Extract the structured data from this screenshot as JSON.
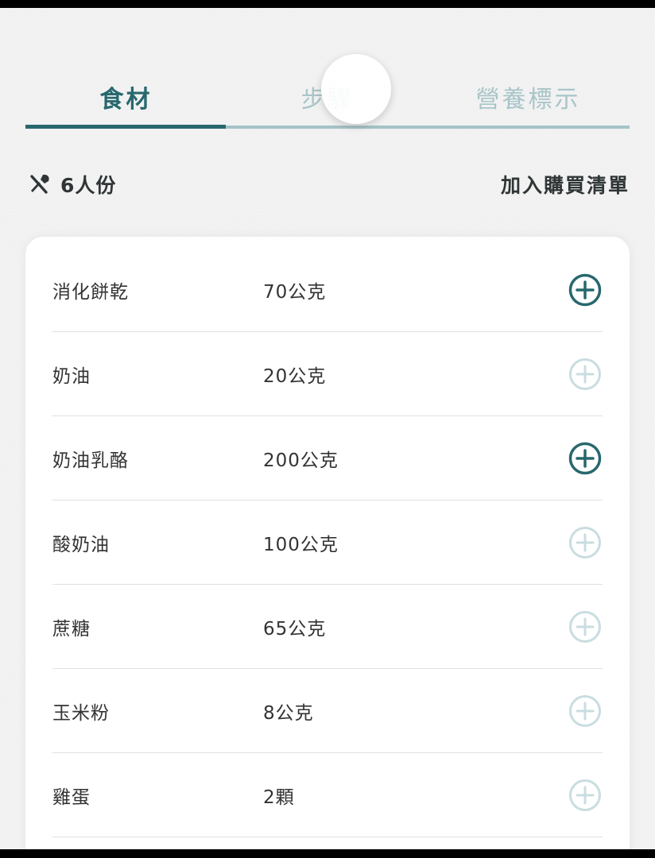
{
  "tabs": [
    {
      "label": "食材",
      "active": true
    },
    {
      "label": "步驟",
      "active": false
    },
    {
      "label": "營養標示",
      "active": false
    }
  ],
  "servings": {
    "icon": "utensils-icon",
    "label": "6人份"
  },
  "add_to_list_label": "加入購買清單",
  "colors": {
    "accent": "#27686d",
    "inactive": "#a9c5c8"
  },
  "ingredients": [
    {
      "name": "消化餅乾",
      "qty": "70公克",
      "selected": true
    },
    {
      "name": "奶油",
      "qty": "20公克",
      "selected": false
    },
    {
      "name": "奶油乳酪",
      "qty": "200公克",
      "selected": true
    },
    {
      "name": "酸奶油",
      "qty": "100公克",
      "selected": false
    },
    {
      "name": "蔗糖",
      "qty": "65公克",
      "selected": false
    },
    {
      "name": "玉米粉",
      "qty": "8公克",
      "selected": false
    },
    {
      "name": "雞蛋",
      "qty": "2顆",
      "selected": false
    }
  ]
}
